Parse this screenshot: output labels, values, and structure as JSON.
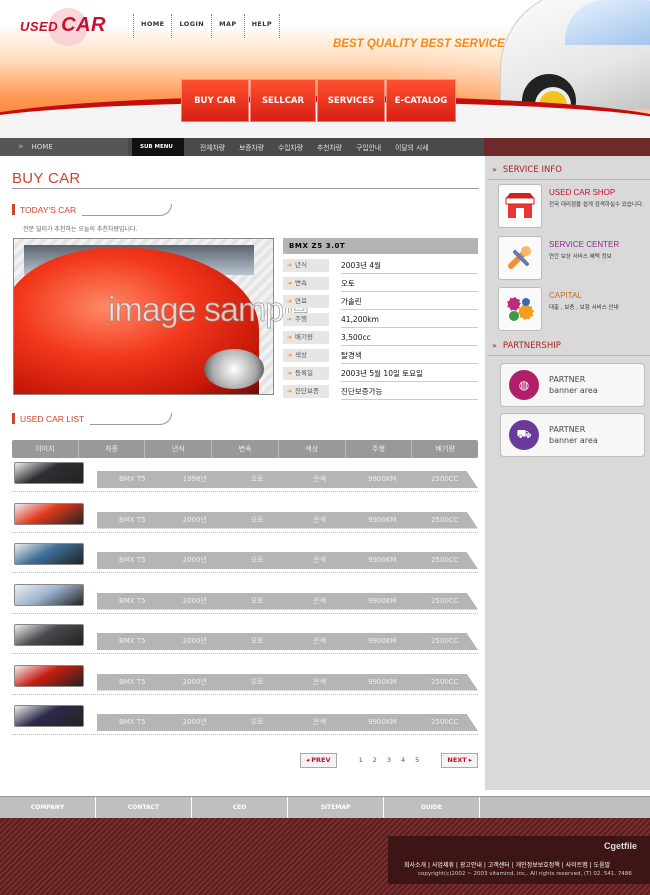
{
  "header": {
    "logo_used": "USED",
    "logo_car": "CAR",
    "topnav": [
      "HOME",
      "LOGIN",
      "MAP",
      "HELP"
    ],
    "slogan": "BEST QUALITY BEST SERVICE",
    "mainmenu": [
      "BUY CAR",
      "SELLCAR",
      "SERVICES",
      "E-CATALOG"
    ]
  },
  "subnav": {
    "home": "HOME",
    "submenu": "SUB MENU",
    "links": [
      "전체차량",
      "보증차량",
      "수입차량",
      "추천차량",
      "구입안내",
      "이달의 시세"
    ]
  },
  "page_title": "BUY CAR",
  "today": {
    "title": "TODAY'S CAR",
    "desc": "전문 딜러가 추천하는 오늘의 추천차량입니다.",
    "image_text": "image sample",
    "model": "BMX Z5 3.0T",
    "specs": [
      {
        "label": "년식",
        "value": "2003년 4월"
      },
      {
        "label": "변속",
        "value": "오토"
      },
      {
        "label": "연료",
        "value": "가솔린"
      },
      {
        "label": "주행",
        "value": "41,200km"
      },
      {
        "label": "배기량",
        "value": "3,500cc"
      },
      {
        "label": "색상",
        "value": "탈경색"
      },
      {
        "label": "등록일",
        "value": "2003년 5월 10일 토요일"
      },
      {
        "label": "진단보증",
        "value": "진단보증가능"
      }
    ]
  },
  "list": {
    "title": "USED CAR LIST",
    "headers": [
      "이미지",
      "차종",
      "년식",
      "변속",
      "색상",
      "주행",
      "배기량"
    ],
    "rows": [
      {
        "model": "BMX T5",
        "year": "1998년",
        "trans": "오토",
        "color": "은색",
        "km": "9900KM",
        "cc": "2500CC"
      },
      {
        "model": "BMX T5",
        "year": "2000년",
        "trans": "오토",
        "color": "은색",
        "km": "9900KM",
        "cc": "2500CC"
      },
      {
        "model": "BMX T5",
        "year": "2000년",
        "trans": "오토",
        "color": "은색",
        "km": "9900KM",
        "cc": "2500CC"
      },
      {
        "model": "BMX T5",
        "year": "2000년",
        "trans": "오토",
        "color": "은색",
        "km": "9900KM",
        "cc": "2500CC"
      },
      {
        "model": "BMX T5",
        "year": "2000년",
        "trans": "오토",
        "color": "은색",
        "km": "9900KM",
        "cc": "2500CC"
      },
      {
        "model": "BMX T5",
        "year": "2000년",
        "trans": "오토",
        "color": "은색",
        "km": "9900KM",
        "cc": "2500CC"
      },
      {
        "model": "BMX T5",
        "year": "2000년",
        "trans": "오토",
        "color": "은색",
        "km": "9900KM",
        "cc": "2500CC"
      }
    ],
    "thumb_colors": [
      "#2f2f33",
      "#e2391c",
      "#3d6f99",
      "#9fb6d0",
      "#4a4a4e",
      "#c81d12",
      "#2b2b4a"
    ],
    "pager": {
      "prev": "PREV",
      "next": "NEXT",
      "pages": [
        "1",
        "2",
        "3",
        "4",
        "5"
      ]
    }
  },
  "sidebar": {
    "service_title": "SERVICE INFO",
    "services": [
      {
        "title": "USED CAR SHOP",
        "desc": "전국 대리점을 쉽게 검색하실수 있습니다.",
        "color": "#c8102e",
        "icon": "shop-icon"
      },
      {
        "title": "SERVICE CENTER",
        "desc": "연간 보상 서비스 혜택 정보",
        "color": "#8a2a8a",
        "icon": "wrench-icon"
      },
      {
        "title": "CAPITAL",
        "desc": "대출 , 보증 , 보험 서비스 안내",
        "color": "#c46b1a",
        "icon": "gears-icon"
      }
    ],
    "partner_title": "PARTNERSHIP",
    "banners": [
      {
        "line1": "PARTNER",
        "line2": "banner area",
        "color": "#b0206a",
        "icon": "globe-icon"
      },
      {
        "line1": "PARTNER",
        "line2": "banner area",
        "color": "#6a3a9a",
        "icon": "truck-icon"
      }
    ]
  },
  "footer": {
    "links": [
      "COMPANY",
      "CONTACT",
      "CEO",
      "SITEMAP",
      "GUIDE"
    ],
    "brand": "Cgetfile",
    "bottom_links": "회사소개 | 사업제휴 | 광고안내 | 고객센터 | 개인정보보호정책 | 사이트맵 | 도움말",
    "copyright": "copyright(c)2002 ~ 2003 vitamind, inc,. All rights reserved, (T) 02. 541. 7486"
  }
}
